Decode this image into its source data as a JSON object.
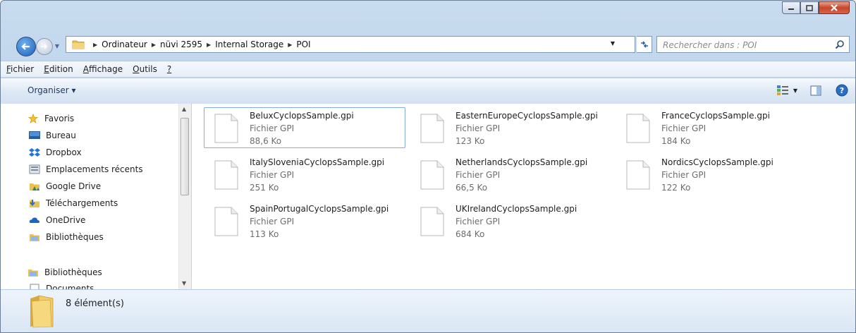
{
  "address": {
    "breadcrumbs": [
      "Ordinateur",
      "nüvi 2595",
      "Internal Storage",
      "POI"
    ]
  },
  "search": {
    "placeholder": "Rechercher dans : POI"
  },
  "menu": {
    "items": [
      {
        "first": "F",
        "rest": "ichier"
      },
      {
        "first": "E",
        "rest": "dition"
      },
      {
        "first": "A",
        "rest": "ffichage"
      },
      {
        "first": "O",
        "rest": "utils"
      },
      {
        "first": "?",
        "rest": ""
      }
    ]
  },
  "toolbar": {
    "organize_label": "Organiser ▾"
  },
  "navpane": {
    "favorites_label": "Favoris",
    "items": [
      "Bureau",
      "Dropbox",
      "Emplacements récents",
      "Google Drive",
      "Téléchargements",
      "OneDrive",
      "Bibliothèques"
    ],
    "libraries_label": "Bibliothèques",
    "documents_label": "Documents"
  },
  "files": [
    {
      "name": "BeluxCyclopsSample.gpi",
      "type": "Fichier GPI",
      "size": "88,6 Ko"
    },
    {
      "name": "EasternEuropeCyclopsSample.gpi",
      "type": "Fichier GPI",
      "size": "123 Ko"
    },
    {
      "name": "FranceCyclopsSample.gpi",
      "type": "Fichier GPI",
      "size": "184 Ko"
    },
    {
      "name": "ItalySloveniaCyclopsSample.gpi",
      "type": "Fichier GPI",
      "size": "251 Ko"
    },
    {
      "name": "NetherlandsCyclopsSample.gpi",
      "type": "Fichier GPI",
      "size": "66,5 Ko"
    },
    {
      "name": "NordicsCyclopsSample.gpi",
      "type": "Fichier GPI",
      "size": "122 Ko"
    },
    {
      "name": "SpainPortugalCyclopsSample.gpi",
      "type": "Fichier GPI",
      "size": "113 Ko"
    },
    {
      "name": "UKIrelandCyclopsSample.gpi",
      "type": "Fichier GPI",
      "size": "684 Ko"
    }
  ],
  "status": {
    "count_text": "8 élément(s)"
  },
  "colors": {
    "accent": "#1c5fb8",
    "selection_border": "#84acdd",
    "chrome": "#c9dcef"
  }
}
